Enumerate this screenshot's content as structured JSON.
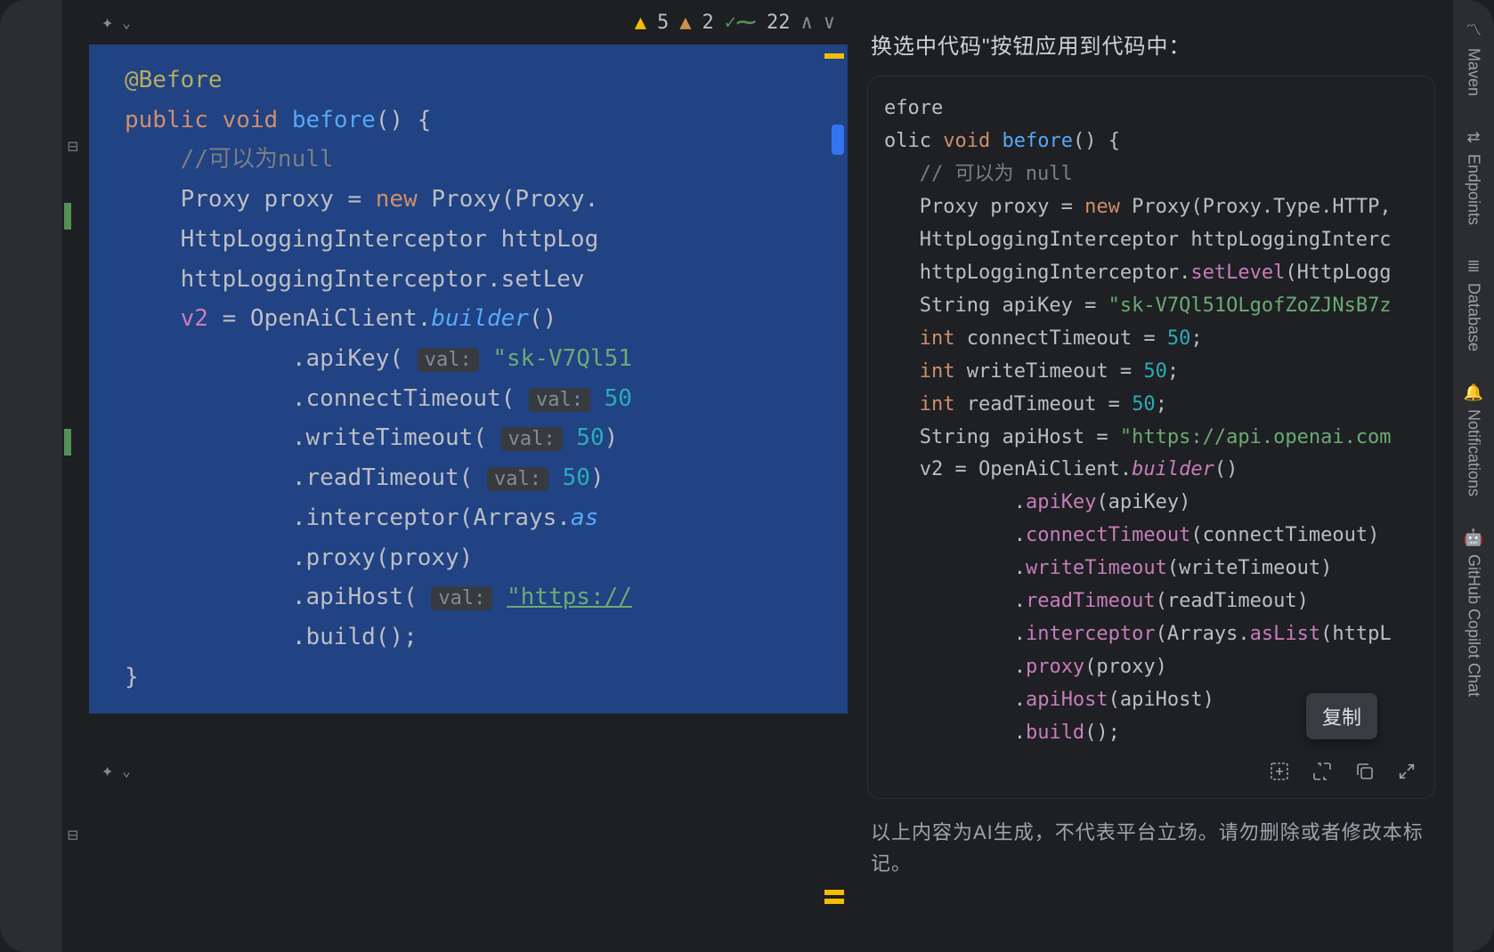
{
  "toolbar": {
    "warning1_count": "5",
    "warning2_count": "2",
    "check_count": "22"
  },
  "editor": {
    "line1_annotation": "@Before",
    "line2_kw1": "public",
    "line2_kw2": "void",
    "line2_method": "before",
    "line2_rest": "() {",
    "line3_comment": "//可以为null",
    "line4_a": "Proxy proxy = ",
    "line4_new": "new",
    "line4_b": " Proxy(Proxy.",
    "line5": "HttpLoggingInterceptor httpLog",
    "line6": "httpLoggingInterceptor.setLev",
    "line7_a": "v2",
    "line7_b": " = OpenAiClient.",
    "line7_c": "builder",
    "line7_d": "()",
    "line8_a": ".apiKey( ",
    "hint_val": "val:",
    "line8_b": " ",
    "line8_str": "\"sk-V7Ql51",
    "line9_a": ".connectTimeout( ",
    "line9_b": " ",
    "line9_num": "50",
    "line10_a": ".writeTimeout( ",
    "line10_num": "50",
    "line10_c": ")",
    "line11_a": ".readTimeout( ",
    "line11_num": "50",
    "line11_c": ")",
    "line12_a": ".interceptor(Arrays.",
    "line12_b": "as",
    "line13": ".proxy(proxy)",
    "line14_a": ".apiHost( ",
    "line14_str": "\"https://",
    "line15": ".build();",
    "line16": "}"
  },
  "panel": {
    "header": "换选中代码\"按钮应用到代码中：",
    "tooltip": "复制",
    "disclaimer": "以上内容为AI生成，不代表平台立场。请勿删除或者修改本标记。"
  },
  "suggestion": {
    "l1": "efore",
    "l2_a": "olic ",
    "l2_b": "void",
    "l2_c": " ",
    "l2_d": "before",
    "l2_e": "() {",
    "l3": "   // 可以为 null",
    "l4_a": "   Proxy proxy = ",
    "l4_b": "new",
    "l4_c": " Proxy(Proxy.Type.HTTP,",
    "l5": "   HttpLoggingInterceptor httpLoggingInterc",
    "l6_a": "   httpLoggingInterceptor.",
    "l6_b": "setLevel",
    "l6_c": "(HttpLogg",
    "l7_a": "   String apiKey = ",
    "l7_b": "\"sk-V7Ql51OLgofZoZJNsB7z",
    "l8_a": "   ",
    "l8_b": "int",
    "l8_c": " connectTimeout = ",
    "l8_d": "50",
    "l8_e": ";",
    "l9_a": "   ",
    "l9_b": "int",
    "l9_c": " writeTimeout = ",
    "l9_d": "50",
    "l9_e": ";",
    "l10_a": "   ",
    "l10_b": "int",
    "l10_c": " readTimeout = ",
    "l10_d": "50",
    "l10_e": ";",
    "l11_a": "   String apiHost = ",
    "l11_b": "\"https://api.openai.com",
    "l12_a": "   v2 = OpenAiClient.",
    "l12_b": "builder",
    "l12_c": "()",
    "l13_a": "           .",
    "l13_b": "apiKey",
    "l13_c": "(apiKey)",
    "l14_a": "           .",
    "l14_b": "connectTimeout",
    "l14_c": "(connectTimeout)",
    "l15_a": "           .",
    "l15_b": "writeTimeout",
    "l15_c": "(writeTimeout)",
    "l16_a": "           .",
    "l16_b": "readTimeout",
    "l16_c": "(readTimeout)",
    "l17_a": "           .",
    "l17_b": "interceptor",
    "l17_c": "(Arrays.",
    "l17_d": "asList",
    "l17_e": "(httpL",
    "l18_a": "           .",
    "l18_b": "proxy",
    "l18_c": "(proxy)",
    "l19_a": "           .",
    "l19_b": "apiHost",
    "l19_c": "(apiHost)",
    "l20_a": "           .",
    "l20_b": "build",
    "l20_c": "();"
  },
  "sidebar": {
    "maven": "Maven",
    "endpoints": "Endpoints",
    "database": "Database",
    "notifications": "Notifications",
    "copilot": "GitHub Copilot Chat"
  }
}
